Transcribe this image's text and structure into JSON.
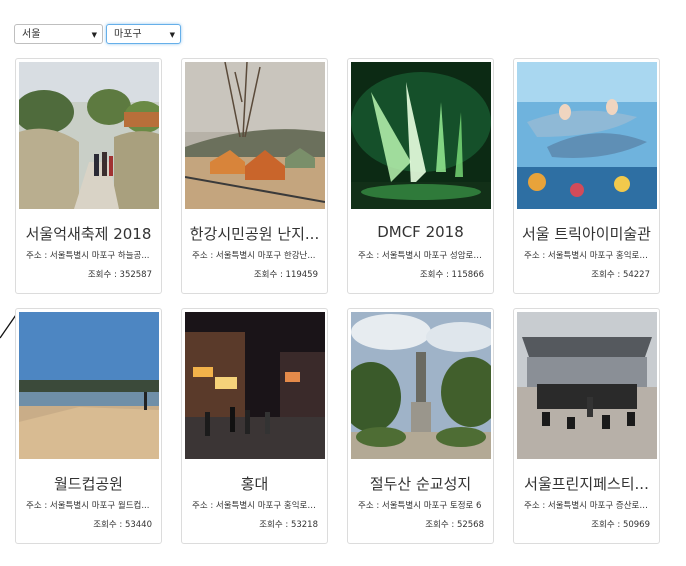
{
  "filters": {
    "region": {
      "value": "서울"
    },
    "district": {
      "value": "마포구"
    }
  },
  "cards": [
    {
      "title": "서울억새축제 2018",
      "address": "주소 : 서울특별시 마포구 하늘공...",
      "views": "조회수 : 352587",
      "image": "silver-grass-field"
    },
    {
      "title": "한강시민공원 난지...",
      "address": "주소 : 서울특별시 마포구 한강난...",
      "views": "조회수 : 119459",
      "image": "camping-tents-park"
    },
    {
      "title": "DMCF 2018",
      "address": "주소 : 서울특별시 마포구 성암로 ...",
      "views": "조회수 : 115866",
      "image": "night-light-sculpture"
    },
    {
      "title": "서울 트릭아이미술관",
      "address": "주소 : 서울특별시 마포구 홍익로3...",
      "views": "조회수 : 54227",
      "image": "trick-art-dolphins"
    },
    {
      "title": "월드컵공원",
      "address": "주소 : 서울특별시 마포구 월드컵...",
      "views": "조회수 : 53440",
      "image": "river-park-sky"
    },
    {
      "title": "홍대",
      "address": "주소 : 서울특별시 마포구 홍익로 20",
      "views": "조회수 : 53218",
      "image": "night-street-shops"
    },
    {
      "title": "절두산 순교성지",
      "address": "주소 : 서울특별시 마포구 토정로 6",
      "views": "조회수 : 52568",
      "image": "statue-garden"
    },
    {
      "title": "서울프린지페스티...",
      "address": "주소 : 서울특별시 마포구 증산로 87",
      "views": "조회수 : 50969",
      "image": "stadium-stage"
    }
  ]
}
